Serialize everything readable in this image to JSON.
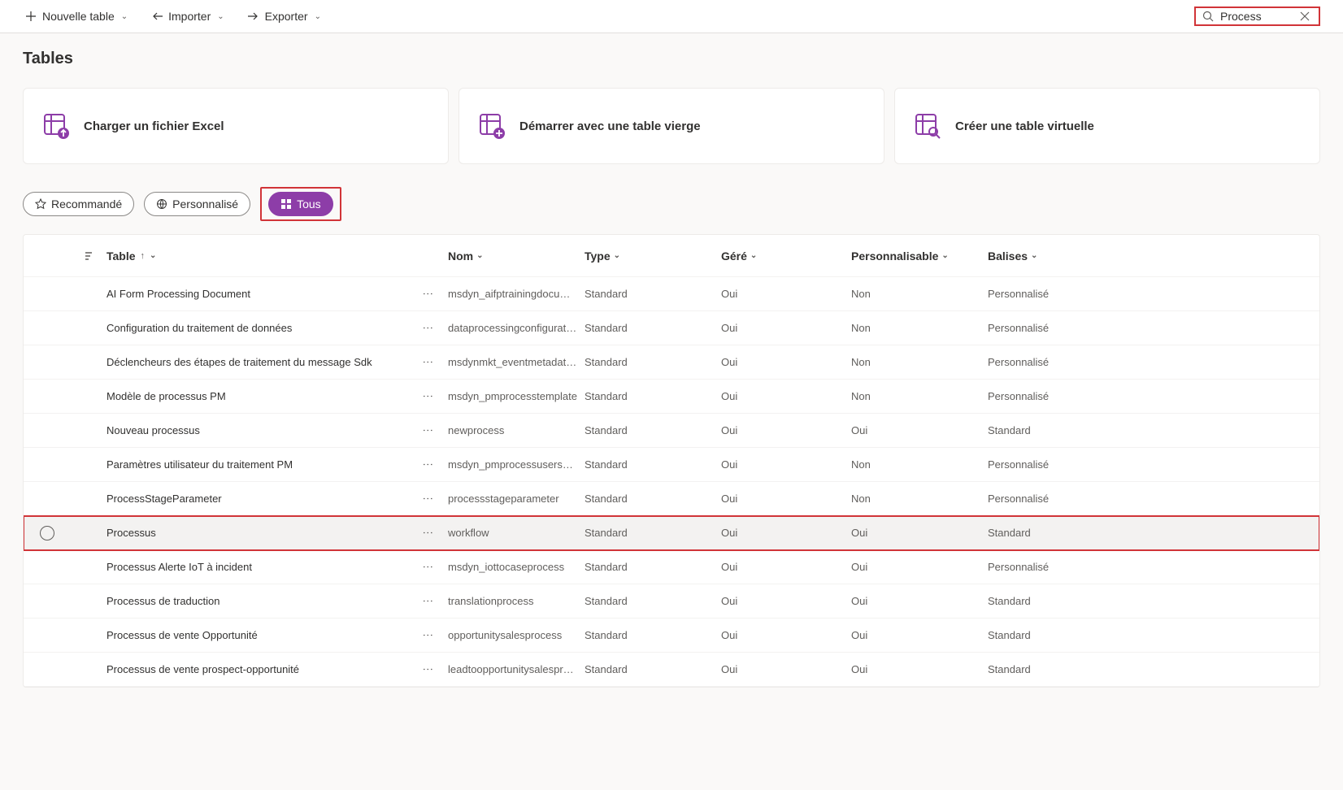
{
  "toolbar": {
    "new_table": "Nouvelle table",
    "import": "Importer",
    "export": "Exporter"
  },
  "search": {
    "value": "Process"
  },
  "page_title": "Tables",
  "cards": {
    "excel": "Charger un fichier Excel",
    "blank": "Démarrer avec une table vierge",
    "virtual": "Créer une table virtuelle"
  },
  "pills": {
    "recommended": "Recommandé",
    "custom": "Personnalisé",
    "all": "Tous"
  },
  "columns": {
    "table": "Table",
    "name": "Nom",
    "type": "Type",
    "managed": "Géré",
    "customizable": "Personnalisable",
    "tags": "Balises"
  },
  "rows": [
    {
      "table": "AI Form Processing Document",
      "name": "msdyn_aifptrainingdocum…",
      "type": "Standard",
      "managed": "Oui",
      "customizable": "Non",
      "tags": "Personnalisé"
    },
    {
      "table": "Configuration du traitement de données",
      "name": "dataprocessingconfigurati…",
      "type": "Standard",
      "managed": "Oui",
      "customizable": "Non",
      "tags": "Personnalisé"
    },
    {
      "table": "Déclencheurs des étapes de traitement du message Sdk",
      "name": "msdynmkt_eventmetadat…",
      "type": "Standard",
      "managed": "Oui",
      "customizable": "Non",
      "tags": "Personnalisé"
    },
    {
      "table": "Modèle de processus PM",
      "name": "msdyn_pmprocesstemplate",
      "type": "Standard",
      "managed": "Oui",
      "customizable": "Non",
      "tags": "Personnalisé"
    },
    {
      "table": "Nouveau processus",
      "name": "newprocess",
      "type": "Standard",
      "managed": "Oui",
      "customizable": "Oui",
      "tags": "Standard"
    },
    {
      "table": "Paramètres utilisateur du traitement PM",
      "name": "msdyn_pmprocessusersett…",
      "type": "Standard",
      "managed": "Oui",
      "customizable": "Non",
      "tags": "Personnalisé"
    },
    {
      "table": "ProcessStageParameter",
      "name": "processstageparameter",
      "type": "Standard",
      "managed": "Oui",
      "customizable": "Non",
      "tags": "Personnalisé"
    },
    {
      "table": "Processus",
      "name": "workflow",
      "type": "Standard",
      "managed": "Oui",
      "customizable": "Oui",
      "tags": "Standard",
      "highlight": true,
      "hover": true
    },
    {
      "table": "Processus Alerte IoT à incident",
      "name": "msdyn_iottocaseprocess",
      "type": "Standard",
      "managed": "Oui",
      "customizable": "Oui",
      "tags": "Personnalisé"
    },
    {
      "table": "Processus de traduction",
      "name": "translationprocess",
      "type": "Standard",
      "managed": "Oui",
      "customizable": "Oui",
      "tags": "Standard"
    },
    {
      "table": "Processus de vente Opportunité",
      "name": "opportunitysalesprocess",
      "type": "Standard",
      "managed": "Oui",
      "customizable": "Oui",
      "tags": "Standard"
    },
    {
      "table": "Processus de vente prospect-opportunité",
      "name": "leadtoopportunitysalespro…",
      "type": "Standard",
      "managed": "Oui",
      "customizable": "Oui",
      "tags": "Standard"
    }
  ]
}
